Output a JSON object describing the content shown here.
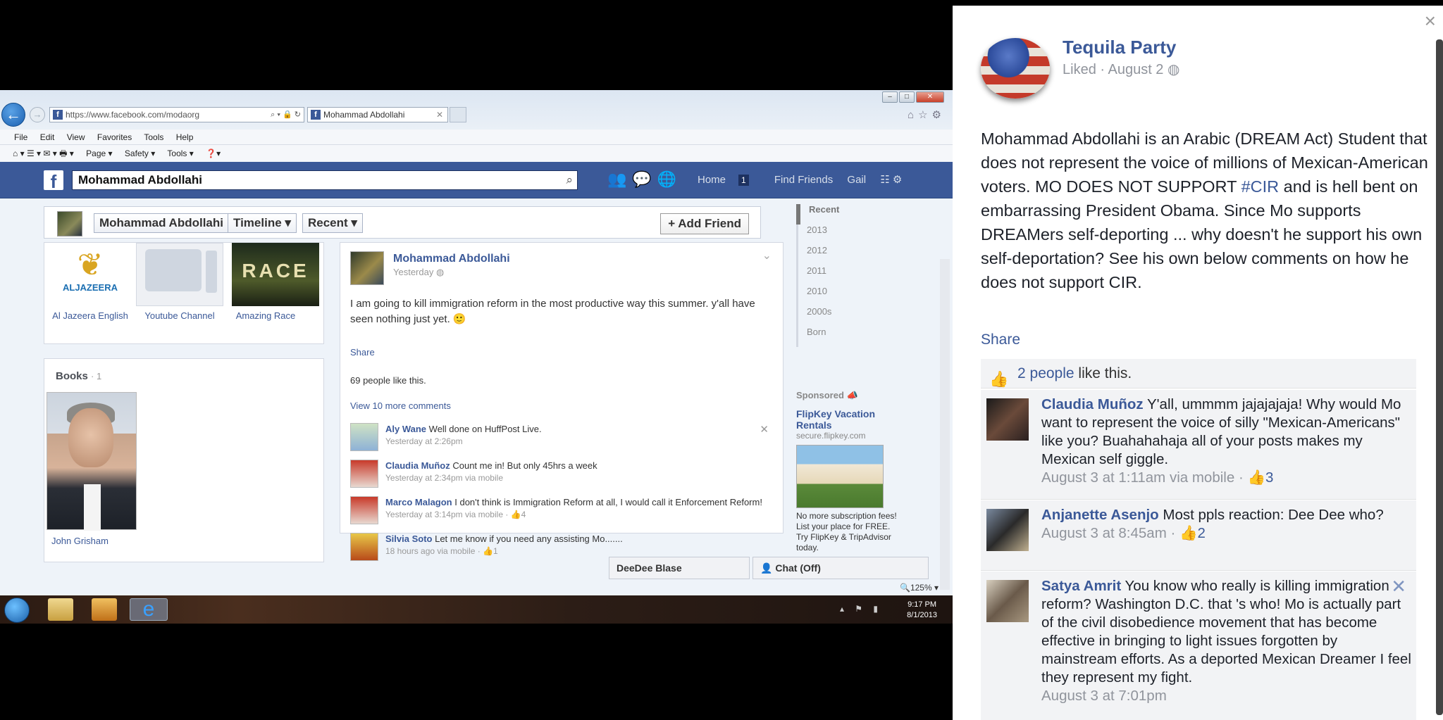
{
  "browser": {
    "url": "https://www.facebook.com/modaorg",
    "tab_title": "Mohammad Abdollahi",
    "menu": [
      "File",
      "Edit",
      "View",
      "Favorites",
      "Tools",
      "Help"
    ],
    "commands": [
      "Page ▾",
      "Safety ▾",
      "Tools ▾"
    ],
    "zoom": "125%"
  },
  "fb": {
    "logo": "f",
    "search_value": "Mohammad Abdollahi",
    "nav": {
      "home": "Home",
      "home_count": "1",
      "find_friends": "Find Friends",
      "user": "Gail"
    }
  },
  "profile": {
    "name": "Mohammad Abdollahi",
    "timeline_label": "Timeline",
    "recent_label": "Recent",
    "add_friend": "Add Friend",
    "favorites": [
      {
        "label": "Al Jazeera English",
        "brand": "ALJAZEERA"
      },
      {
        "label": "Youtube Channel"
      },
      {
        "label": "Amazing Race",
        "brand": "RACE"
      }
    ],
    "books_heading": "Books",
    "books_count": "· 1",
    "book_label": "John Grisham"
  },
  "post": {
    "author": "Mohammad Abdollahi",
    "time": "Yesterday",
    "text": "I am going to kill immigration reform in the most productive way this summer. y'all have seen nothing just yet. 🙂",
    "share": "Share",
    "likes": "69 people like this.",
    "view_more": "View 10 more comments",
    "comments": [
      {
        "name": "Aly Wane",
        "text": "Well done on HuffPost Live.",
        "meta": "Yesterday at 2:26pm"
      },
      {
        "name": "Claudia Muñoz",
        "text": "Count me in! But only 45hrs a week",
        "meta": "Yesterday at 2:34pm via mobile"
      },
      {
        "name": "Marco Malagon",
        "text": "I don't think is Immigration Reform at all, I would call it Enforcement Reform!",
        "meta": "Yesterday at 3:14pm via mobile · 👍4"
      },
      {
        "name": "Silvia Soto",
        "text": "Let me know if you need any assisting Mo.......",
        "meta": "18 hours ago via mobile · 👍1"
      }
    ]
  },
  "timeline_years": [
    "Recent",
    "2013",
    "2012",
    "2011",
    "2010",
    "2000s",
    "Born"
  ],
  "sponsored": {
    "heading": "Sponsored",
    "title": "FlipKey Vacation Rentals",
    "url": "secure.flipkey.com",
    "desc": "No more subscription fees! List your place for FREE. Try FlipKey & TripAdvisor today."
  },
  "chat": {
    "open_chat": "DeeDee Blase",
    "status": "Chat (Off)"
  },
  "taskbar": {
    "time": "9:17 PM",
    "date": "8/1/2013"
  },
  "dialog": {
    "page_name": "Tequila Party",
    "meta": "Liked · August 2",
    "text_before": "Mohammad Abdollahi is an Arabic (DREAM Act) Student that does not represent the voice of millions of Mexican-American voters. MO DOES NOT SUPPORT ",
    "hashtag": "#CIR",
    "text_after": " and is hell bent on embarrassing President Obama. Since Mo supports DREAMers self-deporting ... why doesn't he support his own self-deportation? See his own below comments on how he does not support CIR.",
    "share": "Share",
    "likes_count": "2 people",
    "likes_suffix": " like this.",
    "comments": [
      {
        "name": "Claudia Muñoz",
        "text": " Y'all, ummmm jajajajaja! Why would Mo want to represent the voice of silly \"Mexican-Americans\" like you? Buahahahaja all of your posts makes my Mexican self giggle.",
        "meta": "August 3 at 1:11am via mobile · ",
        "likes": "👍3"
      },
      {
        "name": "Anjanette Asenjo",
        "text": " Most ppls reaction: Dee Dee who?",
        "meta": "August 3 at 8:45am · ",
        "likes": "👍2"
      },
      {
        "name": "Satya Amrit",
        "text": " You know who really is killing immigration reform? Washington D.C. that 's who! Mo is actually part of the civil disobedience movement that has become effective in bringing to light issues forgotten by mainstream efforts. As a deported Mexican Dreamer I feel they represent my fight.",
        "meta": "August 3 at 7:01pm",
        "likes": ""
      }
    ]
  }
}
